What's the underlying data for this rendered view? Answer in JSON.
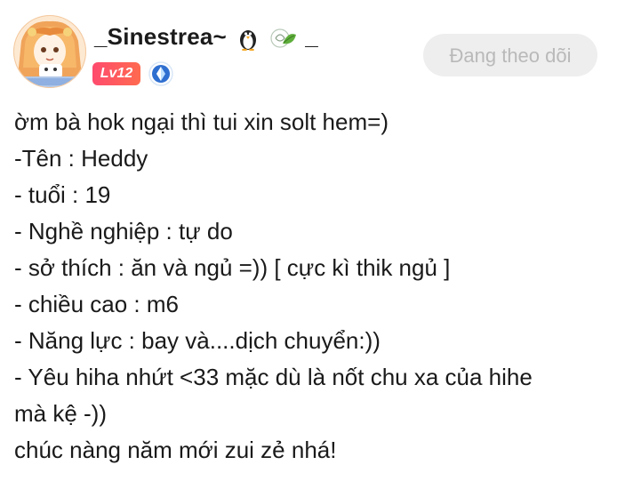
{
  "profile": {
    "username": "_Sinestrea~",
    "username_suffix": "_",
    "username_emojis": [
      "penguin-icon",
      "leaf-snail-icon"
    ],
    "level": "Lv12",
    "level_color": "#ff4b6e",
    "member_badge": "member-badge-icon"
  },
  "follow_button": {
    "label": "Đang theo dõi"
  },
  "post": {
    "lines": [
      "ờm bà hok ngại thì tui xin solt hem=)",
      "-Tên : Heddy",
      "- tuổi : 19",
      "- Nghề nghiệp : tự do",
      "- sở thích : ăn và ngủ =)) [ cực kì thik ngủ ]",
      "- chiều cao : m6",
      "- Năng lực : bay và....dịch chuyển:))",
      "- Yêu hiha nhứt <33 mặc dù là nốt chu xa của hihe",
      "mà kệ -))",
      "chúc nàng năm mới zui zẻ nhá!"
    ]
  }
}
